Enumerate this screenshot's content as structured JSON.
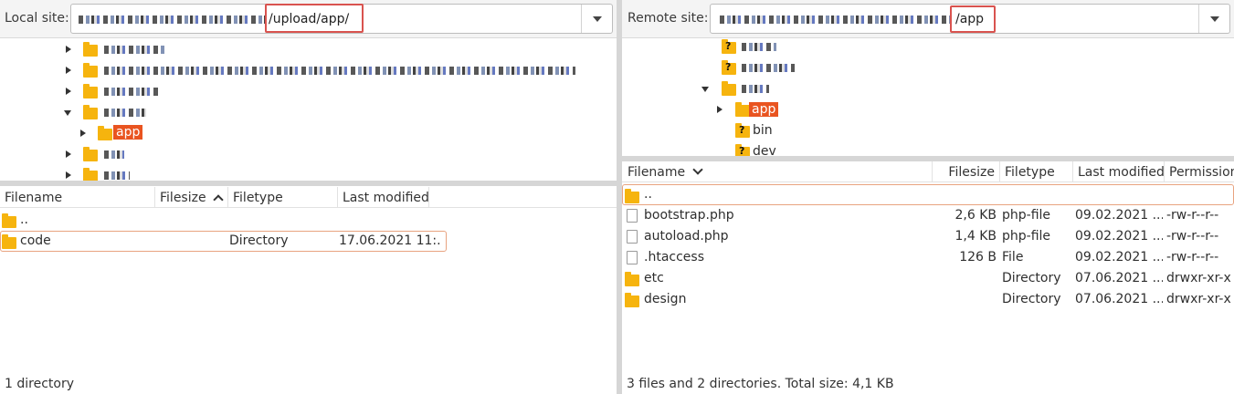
{
  "local": {
    "label": "Local site:",
    "path_visible": "/upload/app/",
    "tree": [
      {
        "label": "",
        "expanded": false
      },
      {
        "label": "",
        "expanded": false
      },
      {
        "label": "",
        "expanded": false
      },
      {
        "label": "",
        "expanded": true
      },
      {
        "label": "app",
        "expanded": false,
        "selected": true
      },
      {
        "label": "",
        "expanded": false
      },
      {
        "label": "",
        "expanded": false
      }
    ],
    "columns": [
      "Filename",
      "Filesize",
      "Filetype",
      "Last modified"
    ],
    "rows": [
      {
        "name": "..",
        "size": "",
        "type": "",
        "modified": ""
      },
      {
        "name": "code",
        "size": "",
        "type": "Directory",
        "modified": "17.06.2021 11:..."
      }
    ],
    "status": "1 directory"
  },
  "remote": {
    "label": "Remote site:",
    "path_visible": "/app",
    "tree": [
      {
        "label": "",
        "unknown": true
      },
      {
        "label": "",
        "unknown": true
      },
      {
        "label": "",
        "expanded": true
      },
      {
        "label": "app",
        "selected": true
      },
      {
        "label": "bin",
        "unknown": true
      },
      {
        "label": "dev",
        "unknown": true
      }
    ],
    "columns": [
      "Filename",
      "Filesize",
      "Filetype",
      "Last modified",
      "Permission"
    ],
    "rows": [
      {
        "name": "..",
        "size": "",
        "type": "",
        "modified": "",
        "perm": ""
      },
      {
        "name": "bootstrap.php",
        "size": "2,6 KB",
        "type": "php-file",
        "modified": "09.02.2021 ...",
        "perm": "-rw-r--r--"
      },
      {
        "name": "autoload.php",
        "size": "1,4 KB",
        "type": "php-file",
        "modified": "09.02.2021 ...",
        "perm": "-rw-r--r--"
      },
      {
        "name": ".htaccess",
        "size": "126 B",
        "type": "File",
        "modified": "09.02.2021 ...",
        "perm": "-rw-r--r--"
      },
      {
        "name": "etc",
        "size": "",
        "type": "Directory",
        "modified": "07.06.2021 ...",
        "perm": "drwxr-xr-x"
      },
      {
        "name": "design",
        "size": "",
        "type": "Directory",
        "modified": "07.06.2021 ...",
        "perm": "drwxr-xr-x"
      }
    ],
    "status": "3 files and 2 directories. Total size: 4,1 KB"
  },
  "colors": {
    "selection": "#e95420",
    "highlight_box": "#d9534f",
    "folder": "#f6b40e",
    "focus_row": "#e8a380"
  }
}
